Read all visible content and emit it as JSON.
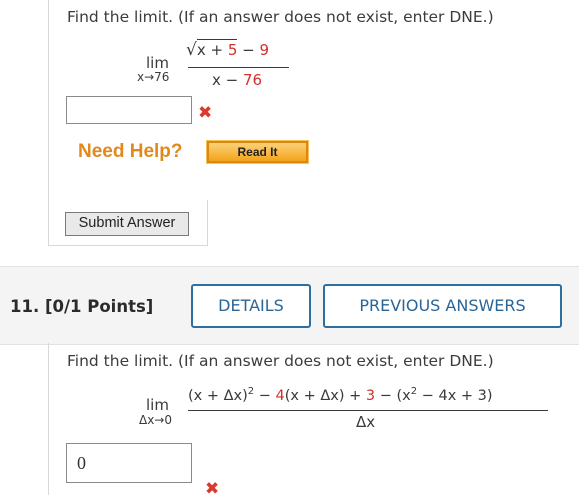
{
  "q10": {
    "prompt": "Find the limit. (If an answer does not exist, enter DNE.)",
    "lim": "lim",
    "lim_sub": "x→76",
    "numerator": {
      "sqrt_body": "x + ",
      "sqrt_num": "5",
      "minus": " − ",
      "const": "9"
    },
    "denominator": {
      "var": "x − ",
      "num": "76"
    },
    "answer_value": "",
    "answer_status": "incorrect",
    "need_help": "Need Help?",
    "read_it": "Read It",
    "submit": "Submit Answer"
  },
  "q11": {
    "number_points": "11.  [0/1 Points]",
    "details": "DETAILS",
    "previous_answers": "PREVIOUS ANSWERS",
    "prompt": "Find the limit. (If an answer does not exist, enter DNE.)",
    "lim": "lim",
    "lim_sub": "Δx→0",
    "numerator": {
      "p1": "(x + Δx)",
      "sup1": "2",
      "p2": " − ",
      "p3": "4",
      "p4": "(x + Δx) + ",
      "p5": "3",
      "p6": " − (x",
      "sup2": "2",
      "p7": " − 4x + 3)"
    },
    "denominator": "Δx",
    "answer_value": "0",
    "answer_status": "incorrect"
  },
  "colors": {
    "accent_blue": "#2a6596",
    "error_red": "#d93a2b",
    "help_orange": "#e08a1e"
  },
  "icons": {
    "wrong": "x-mark-icon"
  }
}
